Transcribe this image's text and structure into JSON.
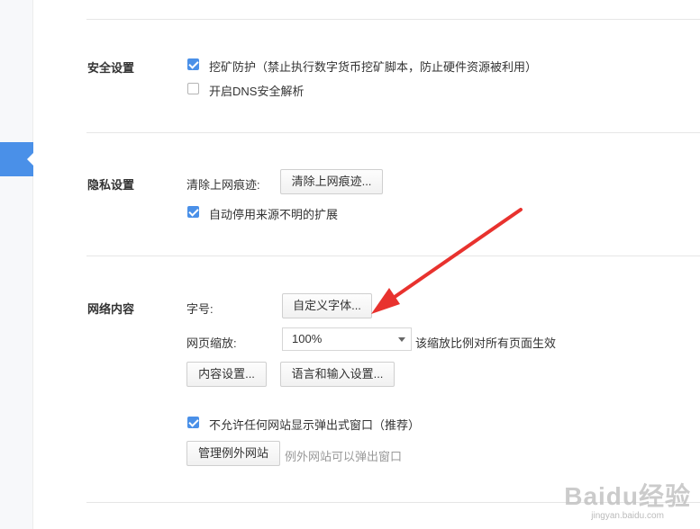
{
  "sidebar": {
    "active_indicator": "active-nav-marker"
  },
  "security": {
    "title": "安全设置",
    "mining_protection": {
      "label": "挖矿防护（禁止执行数字货币挖矿脚本，防止硬件资源被利用）",
      "checked": true
    },
    "dns_security": {
      "label": "开启DNS安全解析",
      "checked": false
    }
  },
  "privacy": {
    "title": "隐私设置",
    "clear_traces_label": "清除上网痕迹:",
    "clear_traces_button": "清除上网痕迹...",
    "disable_unknown_ext": {
      "label": "自动停用来源不明的扩展",
      "checked": true
    }
  },
  "network": {
    "title": "网络内容",
    "font_size_label": "字号:",
    "custom_font_button": "自定义字体...",
    "zoom_label": "网页缩放:",
    "zoom_value": "100%",
    "zoom_hint": "该缩放比例对所有页面生效",
    "content_settings_button": "内容设置...",
    "language_input_button": "语言和输入设置...",
    "block_popups": {
      "label": "不允许任何网站显示弹出式窗口（推荐）",
      "checked": true
    },
    "manage_exceptions_button": "管理例外网站",
    "exceptions_hint": "例外网站可以弹出窗口"
  },
  "annotation": {
    "arrow_color": "#e8322e"
  },
  "watermark": {
    "logo": "Baidu经验",
    "url": "jingyan.baidu.com"
  },
  "colors": {
    "accent": "#4a90e8",
    "text": "#333333",
    "muted": "#999999",
    "divider": "#e6e6e6"
  }
}
